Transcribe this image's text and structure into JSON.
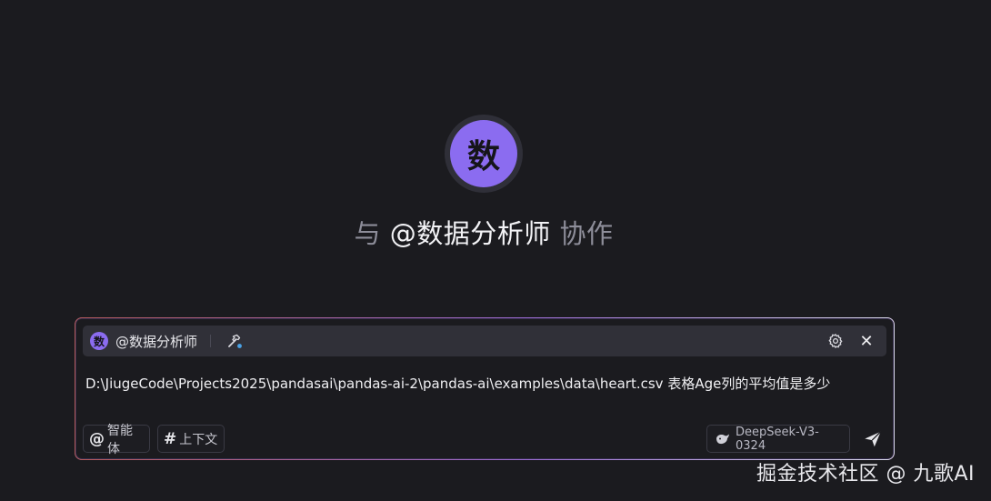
{
  "hero": {
    "avatar_char": "数",
    "prefix": "与",
    "agent": "@数据分析师",
    "suffix": "协作"
  },
  "composer": {
    "agent_bar": {
      "avatar_char": "数",
      "agent_name": "@数据分析师",
      "tool_icon": "hammer-icon",
      "settings_icon": "gear-icon",
      "close_glyph": "✕"
    },
    "message": "D:\\JiugeCode\\Projects2025\\pandasai\\pandas-ai-2\\pandas-ai\\examples\\data\\heart.csv  表格Age列的平均值是多少",
    "chips": {
      "agent_symbol": "@",
      "agent_label": "智能体",
      "context_symbol": "#",
      "context_label": "上下文"
    },
    "model": {
      "icon": "deepseek-whale-icon",
      "label": "DeepSeek-V3-0324"
    },
    "send_icon": "send-icon"
  },
  "watermark": "掘金技术社区 @ 九歌AI",
  "colors": {
    "background": "#1b1b1f",
    "accent": "#8b6cf0"
  }
}
